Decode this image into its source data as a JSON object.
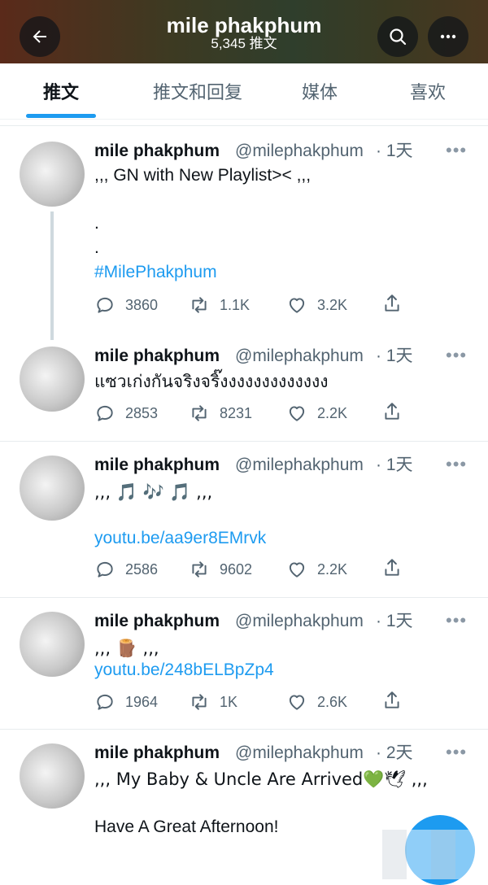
{
  "header": {
    "title": "mile phakphum",
    "tweet_count": "5,345 推文",
    "gradient_colors": [
      "#5a2a1a",
      "#2f3e2c",
      "#4a3720"
    ]
  },
  "tabs": [
    {
      "label": "推文",
      "active": true
    },
    {
      "label": "推文和回复",
      "active": false
    },
    {
      "label": "媒体",
      "active": false
    },
    {
      "label": "喜欢",
      "active": false
    }
  ],
  "accent": "#1d9bf0",
  "tweets": [
    {
      "name": "mile phakphum",
      "handle": "@milephakphum",
      "time": "· 1天",
      "lines": [
        ",,, GN with New Playlist>< ,,,",
        ".",
        ".",
        "#MilePhakphum"
      ],
      "replies": "3860",
      "retweets": "1.1K",
      "likes": "3.2K"
    },
    {
      "name": "mile phakphum",
      "handle": "@milephakphum",
      "time": "· 1天",
      "lines": [
        "แซวเก่งกันจริงจริ๊งงงงงงงงงงงงง"
      ],
      "replies": "2853",
      "retweets": "8231",
      "likes": "2.2K"
    },
    {
      "name": "mile phakphum",
      "handle": "@milephakphum",
      "time": "· 1天",
      "lines": [
        ",,, 🎵 🎶 🎵 ,,,",
        "youtu.be/aa9er8EMrvk"
      ],
      "replies": "2586",
      "retweets": "9602",
      "likes": "2.2K"
    },
    {
      "name": "mile phakphum",
      "handle": "@milephakphum",
      "time": "· 1天",
      "lines": [
        ",,, 🪵 ,,,",
        "youtu.be/248bELBpZp4"
      ],
      "replies": "1964",
      "retweets": "1K",
      "likes": "2.6K"
    },
    {
      "name": "mile phakphum",
      "handle": "@milephakphum",
      "time": "· 2天",
      "lines": [
        ",,, My Baby & Uncle Are Arrived💚🕊 ,,,",
        "Have A Great Afternoon!"
      ]
    }
  ],
  "icons": {
    "back": "back-arrow-icon",
    "search": "search-icon",
    "more": "more-icon",
    "reply": "reply-icon",
    "retweet": "retweet-icon",
    "like": "heart-icon",
    "share": "share-icon"
  }
}
